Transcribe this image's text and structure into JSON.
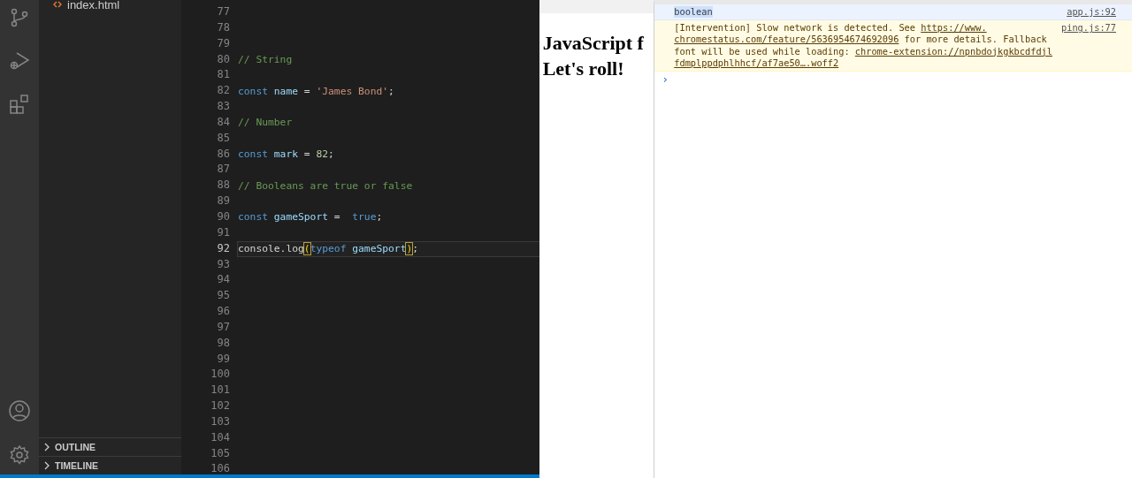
{
  "sidebar": {
    "file": "index.html",
    "sections": [
      {
        "label": "OUTLINE",
        "expanded": false
      },
      {
        "label": "TIMELINE",
        "expanded": false
      }
    ]
  },
  "editor": {
    "lines": [
      {
        "number": "77",
        "current": false
      },
      {
        "number": "78",
        "current": false
      },
      {
        "number": "79",
        "current": false
      },
      {
        "number": "80",
        "current": false,
        "tokens": [
          {
            "kind": "comment",
            "text": "// String"
          }
        ]
      },
      {
        "number": "81",
        "current": false
      },
      {
        "number": "82",
        "current": false,
        "tokens": [
          {
            "kind": "keyword",
            "text": "const"
          },
          {
            "kind": "variable",
            "text": " name"
          },
          {
            "kind": "plain",
            "text": " = "
          },
          {
            "kind": "string",
            "text": "'James Bond'"
          },
          {
            "kind": "plain",
            "text": ";"
          }
        ]
      },
      {
        "number": "83",
        "current": false
      },
      {
        "number": "84",
        "current": false,
        "tokens": [
          {
            "kind": "comment",
            "text": "// Number"
          }
        ]
      },
      {
        "number": "85",
        "current": false
      },
      {
        "number": "86",
        "current": false,
        "tokens": [
          {
            "kind": "keyword",
            "text": "const"
          },
          {
            "kind": "variable",
            "text": " mark"
          },
          {
            "kind": "plain",
            "text": " = "
          },
          {
            "kind": "number",
            "text": "82"
          },
          {
            "kind": "plain",
            "text": ";"
          }
        ]
      },
      {
        "number": "87",
        "current": false
      },
      {
        "number": "88",
        "current": false,
        "tokens": [
          {
            "kind": "comment",
            "text": "// Booleans are true or false"
          }
        ]
      },
      {
        "number": "89",
        "current": false
      },
      {
        "number": "90",
        "current": false,
        "tokens": [
          {
            "kind": "keyword",
            "text": "const"
          },
          {
            "kind": "variable",
            "text": " gameSport"
          },
          {
            "kind": "plain",
            "text": " =  "
          },
          {
            "kind": "keyword",
            "text": "true"
          },
          {
            "kind": "plain",
            "text": ";"
          }
        ]
      },
      {
        "number": "91",
        "current": false
      },
      {
        "number": "92",
        "current": true,
        "tokens": [
          {
            "kind": "plain",
            "text": "console.log"
          },
          {
            "kind": "bracket",
            "text": "("
          },
          {
            "kind": "keyword",
            "text": "typeof"
          },
          {
            "kind": "variable",
            "text": " gameSport"
          },
          {
            "kind": "bracket",
            "text": ")"
          },
          {
            "kind": "plain",
            "text": ";"
          }
        ]
      },
      {
        "number": "93",
        "current": false
      },
      {
        "number": "94",
        "current": false
      },
      {
        "number": "95",
        "current": false
      },
      {
        "number": "96",
        "current": false
      },
      {
        "number": "97",
        "current": false
      },
      {
        "number": "98",
        "current": false
      },
      {
        "number": "99",
        "current": false
      },
      {
        "number": "100",
        "current": false
      },
      {
        "number": "101",
        "current": false
      },
      {
        "number": "102",
        "current": false
      },
      {
        "number": "103",
        "current": false
      },
      {
        "number": "104",
        "current": false
      },
      {
        "number": "105",
        "current": false
      },
      {
        "number": "106",
        "current": false
      }
    ]
  },
  "browser": {
    "heading_lines": [
      "JavaScript f",
      "Let's roll!"
    ]
  },
  "console": {
    "messages": [
      {
        "kind": "log",
        "selected": true,
        "text": "boolean",
        "source": "app.js:92"
      },
      {
        "kind": "warning",
        "selected": false,
        "source": "ping.js:77",
        "lines": [
          [
            {
              "kind": "text",
              "text": "[Intervention] Slow network is detected. See "
            },
            {
              "kind": "link",
              "text": "https://www."
            }
          ],
          [
            {
              "kind": "link",
              "text": "chromestatus.com/feature/5636954674692096"
            },
            {
              "kind": "text",
              "text": " for more details. Fallback"
            }
          ],
          [
            {
              "kind": "text",
              "text": "font will be used while loading: "
            },
            {
              "kind": "link",
              "text": "chrome-extension://npnbdojkgkbcdfdjl"
            }
          ],
          [
            {
              "kind": "link",
              "text": "fdmplppdphlhhcf/af7ae50….woff2"
            }
          ]
        ]
      }
    ],
    "prompt": "›"
  }
}
